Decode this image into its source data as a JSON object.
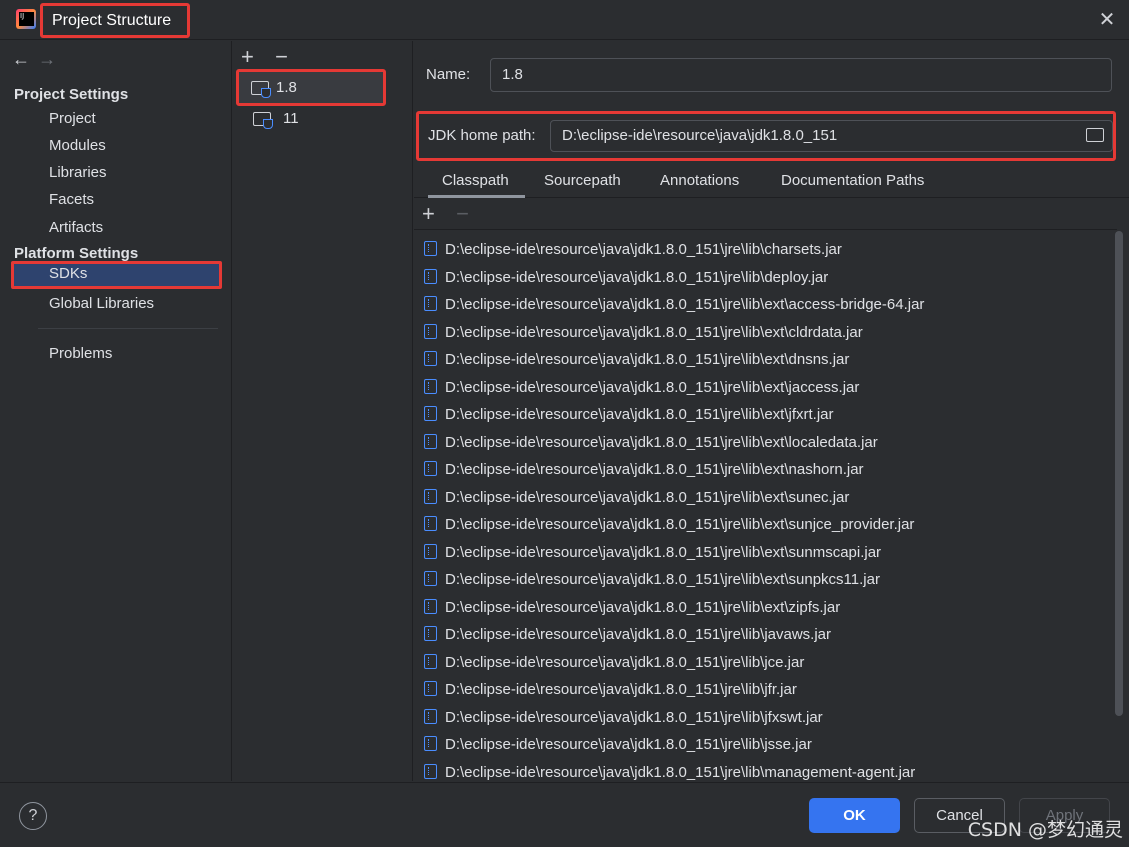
{
  "window": {
    "title": "Project Structure",
    "close_icon": "close-icon"
  },
  "nav": {
    "project_settings_header": "Project Settings",
    "project_settings_items": [
      "Project",
      "Modules",
      "Libraries",
      "Facets",
      "Artifacts"
    ],
    "platform_settings_header": "Platform Settings",
    "platform_settings_items": [
      "SDKs",
      "Global Libraries"
    ],
    "selected": "SDKs",
    "problems": "Problems"
  },
  "sdk_list": {
    "items": [
      "1.8",
      "11"
    ],
    "selected": "1.8"
  },
  "details": {
    "name_label": "Name:",
    "name_value": "1.8",
    "jdk_home_label": "JDK home path:",
    "jdk_home_value": "D:\\eclipse-ide\\resource\\java\\jdk1.8.0_151",
    "tabs": [
      "Classpath",
      "Sourcepath",
      "Annotations",
      "Documentation Paths"
    ],
    "active_tab": "Classpath",
    "classpath": [
      "D:\\eclipse-ide\\resource\\java\\jdk1.8.0_151\\jre\\lib\\charsets.jar",
      "D:\\eclipse-ide\\resource\\java\\jdk1.8.0_151\\jre\\lib\\deploy.jar",
      "D:\\eclipse-ide\\resource\\java\\jdk1.8.0_151\\jre\\lib\\ext\\access-bridge-64.jar",
      "D:\\eclipse-ide\\resource\\java\\jdk1.8.0_151\\jre\\lib\\ext\\cldrdata.jar",
      "D:\\eclipse-ide\\resource\\java\\jdk1.8.0_151\\jre\\lib\\ext\\dnsns.jar",
      "D:\\eclipse-ide\\resource\\java\\jdk1.8.0_151\\jre\\lib\\ext\\jaccess.jar",
      "D:\\eclipse-ide\\resource\\java\\jdk1.8.0_151\\jre\\lib\\ext\\jfxrt.jar",
      "D:\\eclipse-ide\\resource\\java\\jdk1.8.0_151\\jre\\lib\\ext\\localedata.jar",
      "D:\\eclipse-ide\\resource\\java\\jdk1.8.0_151\\jre\\lib\\ext\\nashorn.jar",
      "D:\\eclipse-ide\\resource\\java\\jdk1.8.0_151\\jre\\lib\\ext\\sunec.jar",
      "D:\\eclipse-ide\\resource\\java\\jdk1.8.0_151\\jre\\lib\\ext\\sunjce_provider.jar",
      "D:\\eclipse-ide\\resource\\java\\jdk1.8.0_151\\jre\\lib\\ext\\sunmscapi.jar",
      "D:\\eclipse-ide\\resource\\java\\jdk1.8.0_151\\jre\\lib\\ext\\sunpkcs11.jar",
      "D:\\eclipse-ide\\resource\\java\\jdk1.8.0_151\\jre\\lib\\ext\\zipfs.jar",
      "D:\\eclipse-ide\\resource\\java\\jdk1.8.0_151\\jre\\lib\\javaws.jar",
      "D:\\eclipse-ide\\resource\\java\\jdk1.8.0_151\\jre\\lib\\jce.jar",
      "D:\\eclipse-ide\\resource\\java\\jdk1.8.0_151\\jre\\lib\\jfr.jar",
      "D:\\eclipse-ide\\resource\\java\\jdk1.8.0_151\\jre\\lib\\jfxswt.jar",
      "D:\\eclipse-ide\\resource\\java\\jdk1.8.0_151\\jre\\lib\\jsse.jar",
      "D:\\eclipse-ide\\resource\\java\\jdk1.8.0_151\\jre\\lib\\management-agent.jar"
    ]
  },
  "footer": {
    "help": "?",
    "ok": "OK",
    "cancel": "Cancel",
    "apply": "Apply"
  },
  "watermark": "CSDN @梦幻通灵",
  "colors": {
    "accent": "#3574f0",
    "highlight": "#e53935",
    "selection": "#2e436e"
  }
}
